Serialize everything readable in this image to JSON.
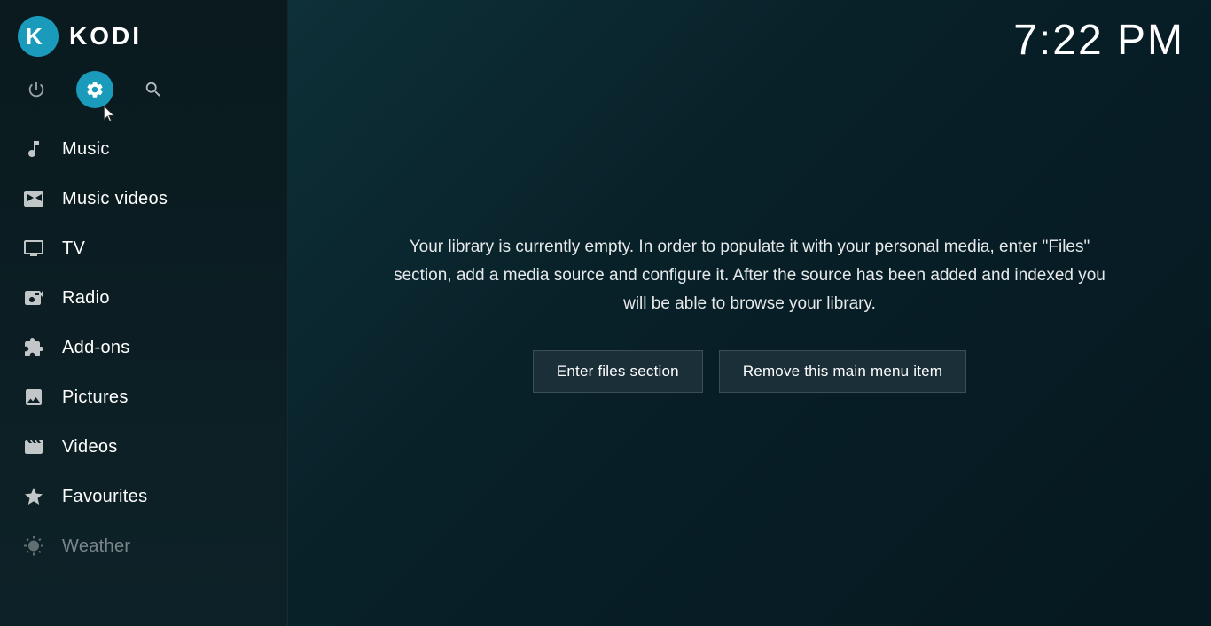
{
  "app": {
    "name": "KODI",
    "clock": "7:22 PM"
  },
  "topIcons": [
    {
      "id": "power",
      "label": "Power",
      "icon": "power-icon",
      "active": false
    },
    {
      "id": "settings",
      "label": "Settings",
      "icon": "settings-icon",
      "active": true
    },
    {
      "id": "search",
      "label": "Search",
      "icon": "search-icon",
      "active": false
    }
  ],
  "navItems": [
    {
      "id": "music",
      "label": "Music",
      "icon": "music-icon",
      "dimmed": false
    },
    {
      "id": "music-videos",
      "label": "Music videos",
      "icon": "music-videos-icon",
      "dimmed": false
    },
    {
      "id": "tv",
      "label": "TV",
      "icon": "tv-icon",
      "dimmed": false
    },
    {
      "id": "radio",
      "label": "Radio",
      "icon": "radio-icon",
      "dimmed": false
    },
    {
      "id": "add-ons",
      "label": "Add-ons",
      "icon": "addons-icon",
      "dimmed": false
    },
    {
      "id": "pictures",
      "label": "Pictures",
      "icon": "pictures-icon",
      "dimmed": false
    },
    {
      "id": "videos",
      "label": "Videos",
      "icon": "videos-icon",
      "dimmed": false
    },
    {
      "id": "favourites",
      "label": "Favourites",
      "icon": "favourites-icon",
      "dimmed": false
    },
    {
      "id": "weather",
      "label": "Weather",
      "icon": "weather-icon",
      "dimmed": true
    }
  ],
  "main": {
    "libraryMessage": "Your library is currently empty. In order to populate it with your personal media, enter \"Files\" section, add a media source and configure it. After the source has been added and indexed you will be able to browse your library.",
    "buttons": {
      "enterFiles": "Enter files section",
      "removeMenuItem": "Remove this main menu item"
    }
  }
}
